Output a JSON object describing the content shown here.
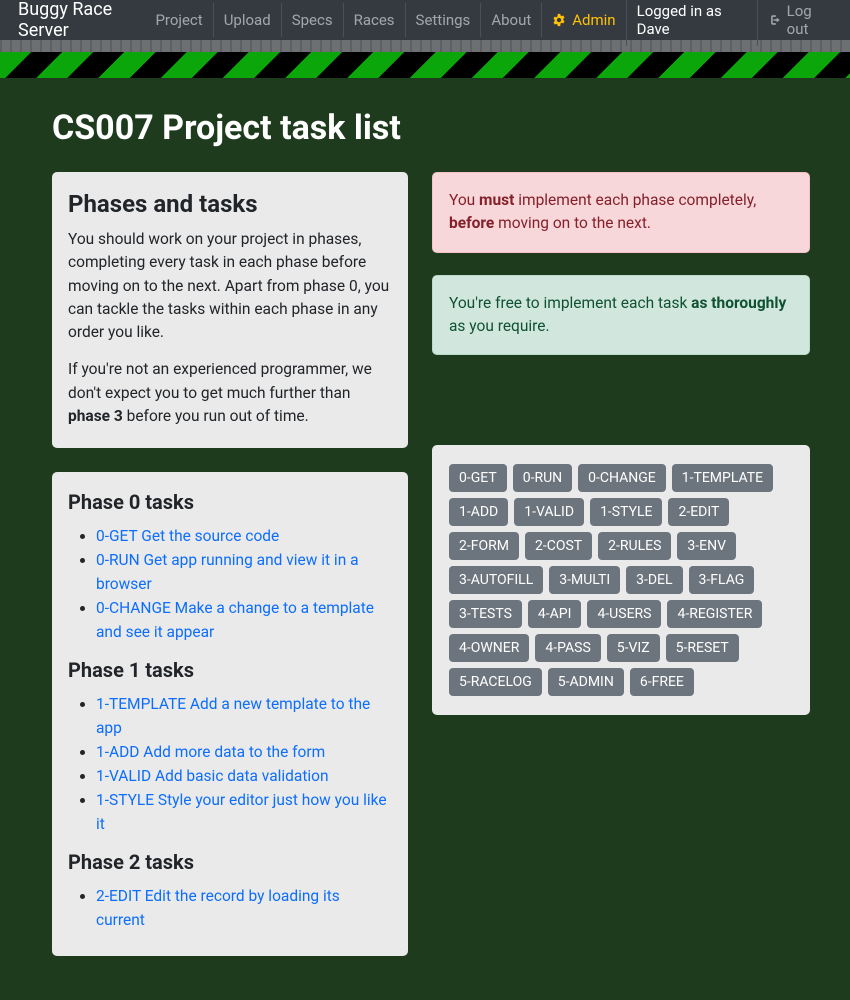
{
  "nav": {
    "brand": "Buggy Race Server",
    "left": [
      "Project",
      "Upload",
      "Specs",
      "Races",
      "Settings",
      "About"
    ],
    "admin": "Admin",
    "logged_in": "Logged in as Dave",
    "logout": "Log out"
  },
  "title": "CS007 Project task list",
  "left_card": {
    "heading": "Phases and tasks",
    "p1_a": "You should work on your project in phases, completing every task in each phase before moving on to the next. Apart from phase 0, you can tackle the tasks within each phase in any order you like.",
    "p2_a": "If you're not an experienced programmer, we don't expect you to get much further than ",
    "p2_b": "phase 3",
    "p2_c": " before you run out of time."
  },
  "phases": [
    {
      "heading": "Phase 0 tasks",
      "items": [
        "0-GET Get the source code",
        "0-RUN Get app running and view it in a browser",
        "0-CHANGE Make a change to a template and see it appear"
      ]
    },
    {
      "heading": "Phase 1 tasks",
      "items": [
        "1-TEMPLATE Add a new template to the app",
        "1-ADD Add more data to the form",
        "1-VALID Add basic data validation",
        "1-STYLE Style your editor just how you like it"
      ]
    },
    {
      "heading": "Phase 2 tasks",
      "items": [
        "2-EDIT Edit the record by loading its current"
      ]
    }
  ],
  "alerts": {
    "danger_a": "You ",
    "danger_b": "must",
    "danger_c": " implement each phase completely, ",
    "danger_d": "before",
    "danger_e": " moving on to the next.",
    "success_a": "You're free to implement each task ",
    "success_b": "as thoroughly",
    "success_c": " as you require."
  },
  "tags": [
    "0-GET",
    "0-RUN",
    "0-CHANGE",
    "1-TEMPLATE",
    "1-ADD",
    "1-VALID",
    "1-STYLE",
    "2-EDIT",
    "2-FORM",
    "2-COST",
    "2-RULES",
    "3-ENV",
    "3-AUTOFILL",
    "3-MULTI",
    "3-DEL",
    "3-FLAG",
    "3-TESTS",
    "4-API",
    "4-USERS",
    "4-REGISTER",
    "4-OWNER",
    "4-PASS",
    "5-VIZ",
    "5-RESET",
    "5-RACELOG",
    "5-ADMIN",
    "6-FREE"
  ]
}
